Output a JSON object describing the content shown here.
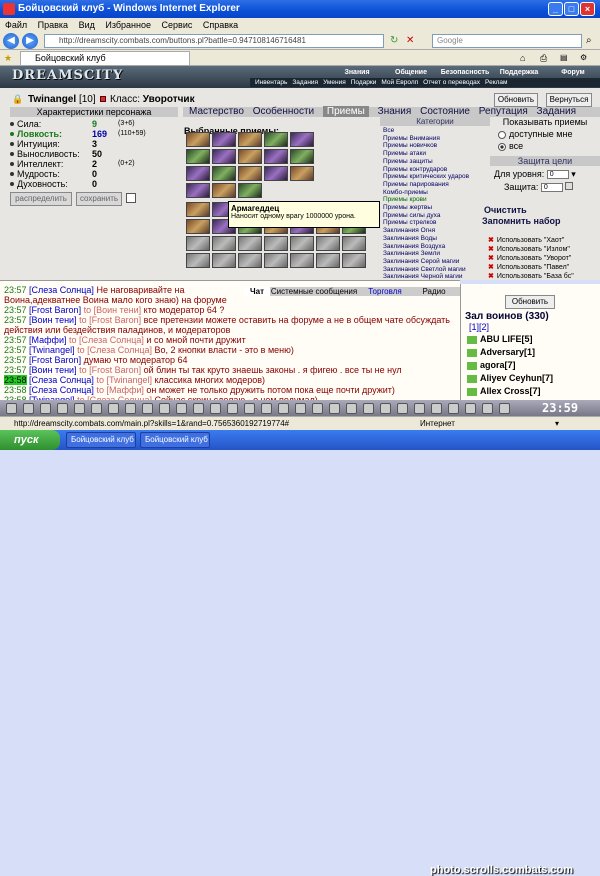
{
  "window": {
    "title": "Бойцовский клуб - Windows Internet Explorer"
  },
  "menu": [
    "Файл",
    "Правка",
    "Вид",
    "Избранное",
    "Сервис",
    "Справка"
  ],
  "address": {
    "url": "http://dreamscity.combats.com/buttons.pl?battle=0.947108146716481",
    "search_placeholder": "Google"
  },
  "tab": {
    "label": "Бойцовский клуб"
  },
  "banner": {
    "logo": "DREAMSCITY",
    "topnav": [
      "Знания",
      "Общение",
      "Безопасность",
      "Поддержка",
      "Форум"
    ],
    "subnav": [
      "Инвентарь",
      "Задания",
      "Умения",
      "Подарки",
      "Мой Евролп",
      "Отчет о переводах",
      "Реклам"
    ]
  },
  "character": {
    "name": "Twinangel",
    "level": "[10]",
    "class_label": "Класс:",
    "class_value": "Уворотчик",
    "header": "Характеристики персонажа",
    "stats": [
      {
        "label": "Сила:",
        "value": "9",
        "extra": "(3+6)"
      },
      {
        "label": "Ловкость:",
        "value": "169",
        "extra": "(110+59)"
      },
      {
        "label": "Интуиция:",
        "value": "3",
        "extra": ""
      },
      {
        "label": "Выносливость:",
        "value": "50",
        "extra": ""
      },
      {
        "label": "Интеллект:",
        "value": "2",
        "extra": "(0+2)"
      },
      {
        "label": "Мудрость:",
        "value": "0",
        "extra": ""
      },
      {
        "label": "Духовность:",
        "value": "0",
        "extra": ""
      }
    ],
    "distribute_btn": "распределить",
    "save_btn": "сохранить"
  },
  "tabs": [
    "Мастерство",
    "Особенности",
    "Приемы",
    "Знания",
    "Состояние",
    "Репутация",
    "Задания"
  ],
  "active_tab": "Приемы",
  "buttons": {
    "refresh": "Обновить",
    "back": "Вернуться"
  },
  "selected_header": "Выбранные приемы:",
  "tooltip": {
    "title": "Армагеддец",
    "text": "Наносит одному врагу 1000000 урона."
  },
  "categories": {
    "header": "Категории",
    "items": [
      "Все",
      "Приемы Внимания",
      "Приемы новичков",
      "Приемы атаки",
      "Приемы защиты",
      "Приемы контрударов",
      "Приемы критических ударов",
      "Приемы парирования",
      "Комбо-приемы",
      "Приемы крови",
      "Приемы жертвы",
      "Приемы силы духа",
      "Приемы стрелков",
      "Заклинания Огня",
      "Заклинания Воды",
      "Заклинания Воздуха",
      "Заклинания Земли",
      "Заклинания Серой магии",
      "Заклинания Светлой магии",
      "Заклинания Черной магии"
    ]
  },
  "show": {
    "header": "Показывать приемы",
    "opt1": "доступные мне",
    "opt2": "все"
  },
  "protect": {
    "header": "Защита цели",
    "level_label": "Для уровня:",
    "level_value": "0",
    "protect_label": "Защита:",
    "protect_value": "0"
  },
  "links": {
    "clear": "Очистить",
    "remember": "Запомнить набор"
  },
  "use_list": [
    "Использовать \"Хаот\"",
    "Использовать \"Излом\"",
    "Использовать \"Уворот\"",
    "Использовать \"Павел\"",
    "Использовать \"База бс\""
  ],
  "chat_tabs": [
    "Чат",
    "Системные сообщения",
    "Торговля",
    "Радио"
  ],
  "chat": [
    {
      "time": "23:57",
      "nick": "[Слеза Солнца]",
      "to": "",
      "msg": "Не наговаривайте на Воина,адекватнее Воина мало кого знаю) на форуме даже иногда никто кнопки власти\""
    },
    {
      "time": "23:57",
      "nick": "[Frost Baron]",
      "to": "to [Воин тени]",
      "msg": "кто модератор 64 ?"
    },
    {
      "time": "23:57",
      "nick": "[Воин тени]",
      "to": "to [Frost Baron]",
      "msg": "все претензии можете оставить на форуме а не в общем чате обсуждать действия или бездействия паладинов, и модераторов"
    },
    {
      "time": "23:57",
      "nick": "[Маффи]",
      "to": "to [Слеза Солнца]",
      "msg": "и со мной почти дружит"
    },
    {
      "time": "23:57",
      "nick": "[Twinangel]",
      "to": "to [Слеза Солнца]",
      "msg": "Во, 2 кнопки власти - это в меню)"
    },
    {
      "time": "23:57",
      "nick": "[Frost Baron]",
      "to": "",
      "msg": "думаю что модератор 64"
    },
    {
      "time": "23:57",
      "nick": "[Воин тени]",
      "to": "to [Frost Baron]",
      "msg": "ой блин ты так круто знаешь законы . я фигею . все ты не нул"
    },
    {
      "time": "23:58",
      "nick": "[Слеза Солнца]",
      "to": "to [Twinangel]",
      "msg": "классика многих модеров)"
    },
    {
      "time": "23:58",
      "nick": "[Слеза Солнца]",
      "to": "to [Маффи]",
      "msg": "он может не только дружить потом пока еще почти дружит)"
    },
    {
      "time": "23:58",
      "nick": "[Twinangel]",
      "to": "to [Слеза Солнца]",
      "msg": "Сейчас скрин сделаю - о чем подумал)"
    }
  ],
  "hall": {
    "refresh": "Обновить",
    "title": "Зал воинов (330)",
    "pages": "[1][2]",
    "users": [
      "ABU LIFE[5]",
      "Adversary[1]",
      "agora[7]",
      "Aliyev Ceyhun[7]",
      "Allex Cross[7]"
    ]
  },
  "clock": "23:59",
  "status_url": "http://dreamscity.combats.com/main.pl?skills=1&rand=0.7565360192719774#",
  "status_zone": "Интернет",
  "taskbar": {
    "start": "пуск",
    "tasks": [
      "Бойцовский клуб - ...",
      "Бойцовский клуб - ..."
    ]
  },
  "watermark": "photo.scrolls.combats.com"
}
